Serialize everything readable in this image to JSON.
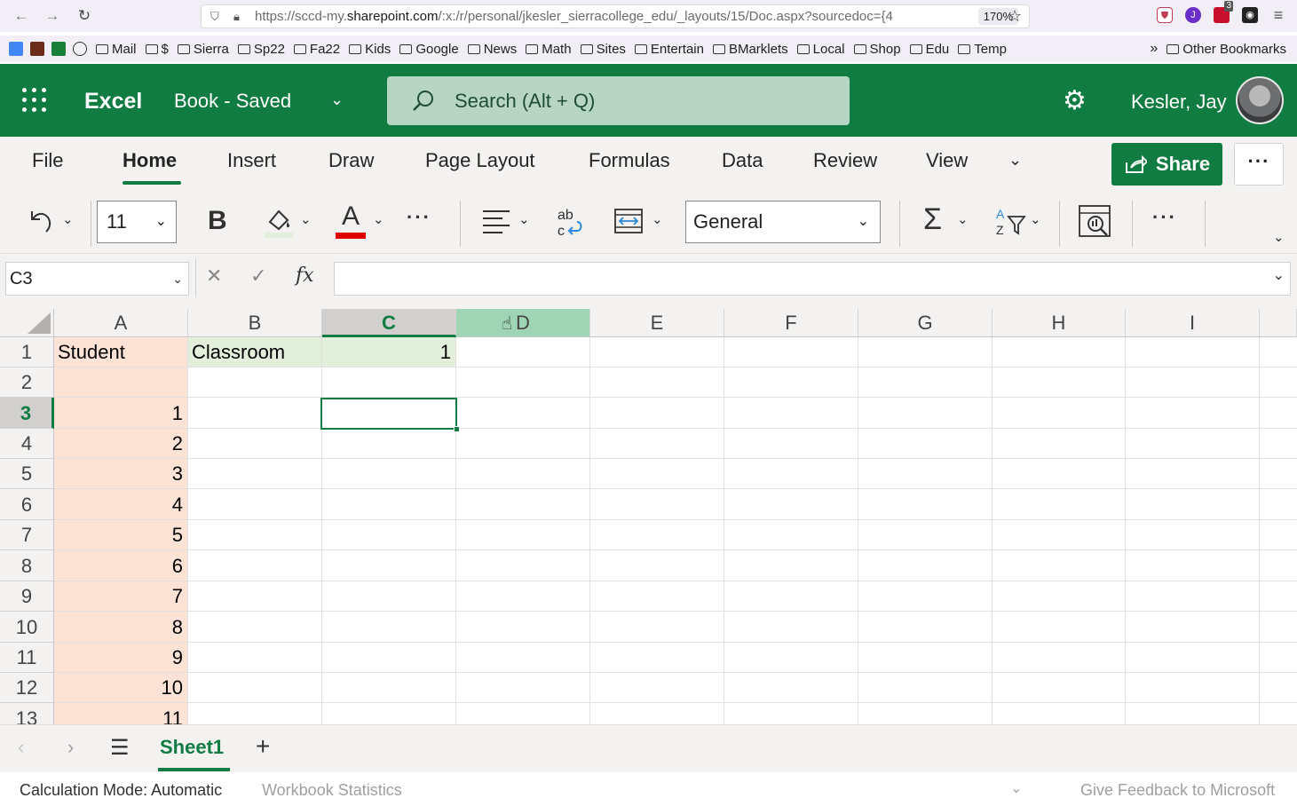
{
  "browser": {
    "url_prefix": "https://sccd-my.",
    "url_domain": "sharepoint.com",
    "url_rest": "/:x:/r/personal/jkesler_sierracollege_edu/_layouts/15/Doc.aspx?sourcedoc={4",
    "zoom": "170%",
    "ext_badge": "3",
    "bookmarks": [
      "Mail",
      "$",
      "Sierra",
      "Sp22",
      "Fa22",
      "Kids",
      "Google",
      "News",
      "Math",
      "Sites",
      "Entertain",
      "BMarklets",
      "Local",
      "Shop",
      "Edu",
      "Temp"
    ],
    "other_bookmarks": "Other Bookmarks"
  },
  "header": {
    "app_name": "Excel",
    "doc_title": "Book  -  Saved",
    "search_placeholder": "Search (Alt + Q)",
    "user_name": "Kesler, Jay"
  },
  "ribbon": {
    "tabs": [
      "File",
      "Home",
      "Insert",
      "Draw",
      "Page Layout",
      "Formulas",
      "Data",
      "Review",
      "View"
    ],
    "active_tab": "Home",
    "share_label": "Share",
    "more_label": "···",
    "font_size": "11",
    "number_format": "General",
    "bold_label": "B",
    "font_color_label": "A"
  },
  "formula_bar": {
    "name_box": "C3",
    "formula": ""
  },
  "grid": {
    "columns": [
      "A",
      "B",
      "C",
      "D",
      "E",
      "F",
      "G",
      "H",
      "I"
    ],
    "rows": [
      "1",
      "2",
      "3",
      "4",
      "5",
      "6",
      "7",
      "8",
      "9",
      "10",
      "11",
      "12",
      "13"
    ],
    "selected_cell": "C3",
    "cells": {
      "A1": "Student",
      "B1": "Classroom",
      "C1": "1",
      "A3": "1",
      "A4": "2",
      "A5": "3",
      "A6": "4",
      "A7": "5",
      "A8": "6",
      "A9": "7",
      "A10": "8",
      "A11": "9",
      "A12": "10",
      "A13": "11"
    }
  },
  "sheets": {
    "tabs": [
      "Sheet1"
    ],
    "active": "Sheet1"
  },
  "status": {
    "calc_mode": "Calculation Mode: Automatic",
    "workbook_stats": "Workbook Statistics",
    "feedback": "Give Feedback to Microsoft"
  },
  "colors": {
    "excel_green": "#107c41",
    "student_fill": "#fde3d6",
    "header_fill": "#e2efda"
  }
}
